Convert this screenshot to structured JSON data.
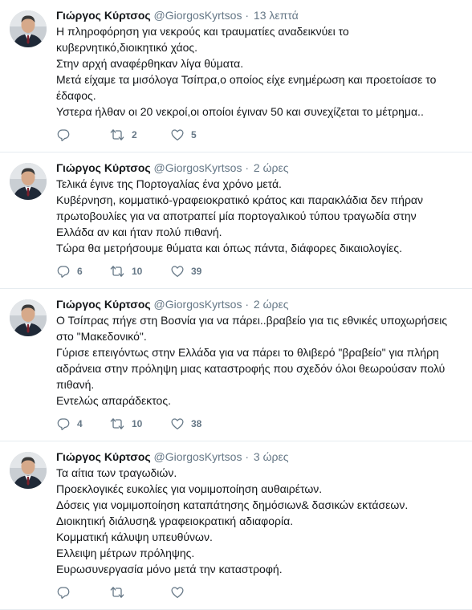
{
  "tweets": [
    {
      "name": "Γιώργος Κύρτσος",
      "handle": "@GiorgosKyrtsos",
      "separator": "·",
      "time": "13 λεπτά",
      "lines": [
        "Η πληροφόρηση για νεκρούς και τραυματίες αναδεικνύει το",
        "κυβερνητικό,διοικητικό χάος.",
        "Στην αρχή αναφέρθηκαν λίγα θύματα.",
        "Μετά είχαμε τα μισόλογα Τσίπρα,ο οποίος είχε ενημέρωση και προετοίασε το",
        "έδαφος.",
        "Υστερα ήλθαν οι 20 νεκροί,οι οποίοι έγιναν 50 και συνεχίζεται το μέτρημα.."
      ],
      "replies": "",
      "retweets": "2",
      "likes": "5"
    },
    {
      "name": "Γιώργος Κύρτσος",
      "handle": "@GiorgosKyrtsos",
      "separator": "·",
      "time": "2 ώρες",
      "lines": [
        "Τελικά έγινε της Πορτογαλίας ένα χρόνο μετά.",
        "Κυβέρνηση, κομματικό-γραφειοκρατικό κράτος και παρακλάδια δεν πήραν",
        "πρωτοβουλίες για να αποτραπεί μία πορτογαλικού τύπου τραγωδία στην",
        "Ελλάδα αν και ήταν πολύ πιθανή.",
        "Τώρα θα μετρήσουμε θύματα και όπως πάντα, διάφορες δικαιολογίες."
      ],
      "replies": "6",
      "retweets": "10",
      "likes": "39"
    },
    {
      "name": "Γιώργος Κύρτσος",
      "handle": "@GiorgosKyrtsos",
      "separator": "·",
      "time": "2 ώρες",
      "lines": [
        "Ο Τσίπρας πήγε στη Βοσνία για να πάρει..βραβείο για τις εθνικές υποχωρήσεις",
        "στο \"Μακεδονικό\".",
        "Γύρισε επειγόντως στην Ελλάδα για να πάρει το θλιβερό \"βραβείο\" για πλήρη",
        "αδράνεια στην πρόληψη μιας καταστροφής που σχεδόν όλοι θεωρούσαν πολύ",
        "πιθανή.",
        "Εντελώς απαράδεκτος."
      ],
      "replies": "4",
      "retweets": "10",
      "likes": "38"
    },
    {
      "name": "Γιώργος Κύρτσος",
      "handle": "@GiorgosKyrtsos",
      "separator": "·",
      "time": "3 ώρες",
      "lines": [
        "Τα αίτια των τραγωδιών.",
        "Προεκλογικές ευκολίες για νομιμοποίηση αυθαιρέτων.",
        "Δόσεις για νομιμοποίηση καταπάτησης δημόσιων& δασικών εκτάσεων.",
        "Διοικητική διάλυση& γραφειοκρατική αδιαφορία.",
        "Κομματική κάλυψη υπευθύνων.",
        "Ελλειψη μέτρων πρόληψης.",
        "Ευρωσυνεργασία μόνο μετά την καταστροφή."
      ],
      "replies": "",
      "retweets": "",
      "likes": ""
    }
  ],
  "icons": {
    "reply": "reply-icon",
    "retweet": "retweet-icon",
    "like": "heart-icon"
  },
  "colors": {
    "text": "#14171a",
    "secondary": "#657786",
    "divider": "#e6ecf0"
  }
}
